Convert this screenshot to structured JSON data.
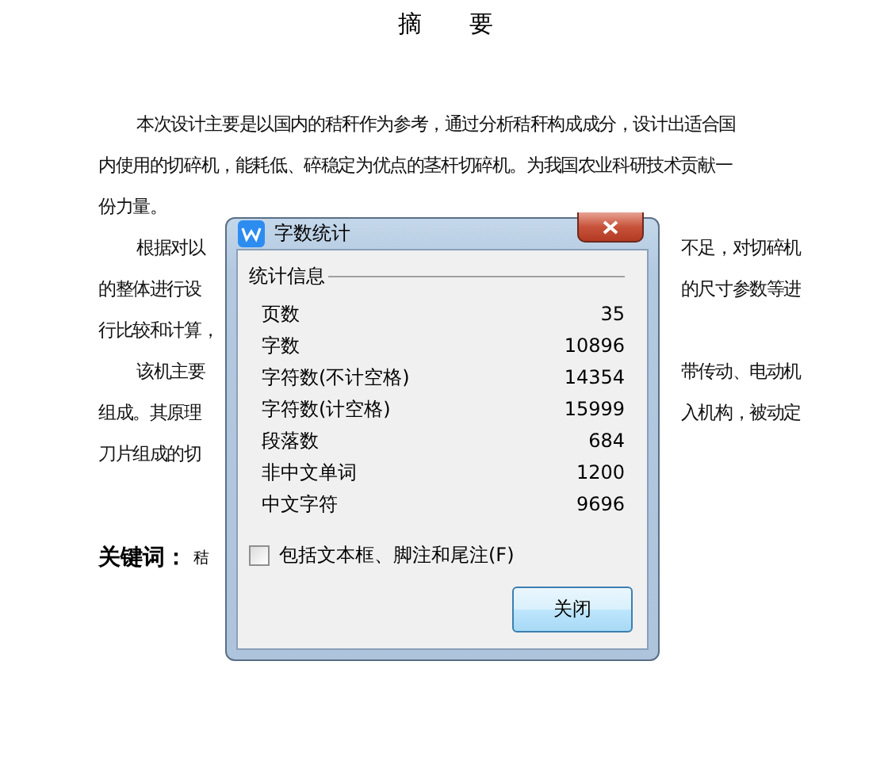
{
  "document": {
    "title": "摘　　要",
    "paragraphs": [
      {
        "lines": [
          {
            "left": "本次设计主要是以国内的秸秆作为参考，通过分析秸秆构成成分，设计出适合国"
          },
          {
            "left": "内使用的切碎机，能耗低、碎稳定为优点的茎杆切碎机。为我国农业科研技术贡献一"
          },
          {
            "left": "份力量。"
          }
        ]
      },
      {
        "lines": [
          {
            "left": "根据对以",
            "right": "不足，对切碎机"
          },
          {
            "left": "的整体进行设",
            "right": "的尺寸参数等进"
          },
          {
            "left": "行比较和计算，"
          }
        ]
      },
      {
        "lines": [
          {
            "left": "该机主要",
            "right": "带传动、电动机"
          },
          {
            "left": "组成。其原理",
            "right": "入机构，被动定"
          },
          {
            "left": "刀片组成的切"
          }
        ]
      }
    ],
    "keywords_label": "关键词：",
    "keywords": "秸"
  },
  "dialog": {
    "title": "字数统计",
    "group_title": "统计信息",
    "stats": [
      {
        "label": "页数",
        "value": "35"
      },
      {
        "label": "字数",
        "value": "10896"
      },
      {
        "label": "字符数(不计空格)",
        "value": "14354"
      },
      {
        "label": "字符数(计空格)",
        "value": "15999"
      },
      {
        "label": "段落数",
        "value": "684"
      },
      {
        "label": "非中文单词",
        "value": "1200"
      },
      {
        "label": "中文字符",
        "value": "9696"
      }
    ],
    "checkbox": {
      "label": "包括文本框、脚注和尾注(F)",
      "checked": false
    },
    "button": "关闭"
  }
}
